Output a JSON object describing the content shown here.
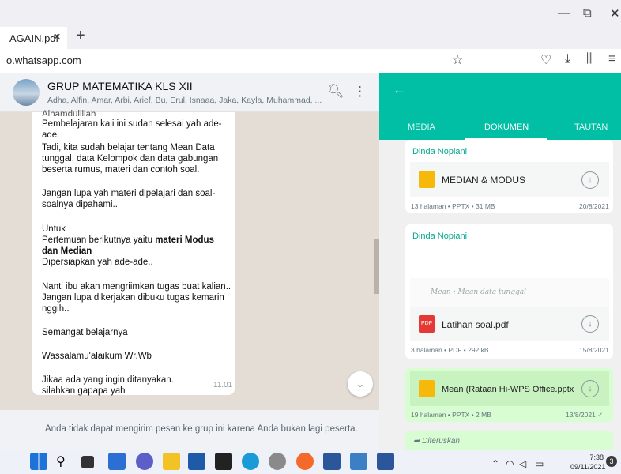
{
  "browser": {
    "tab_title": "AGAIN.pdf",
    "tab_close": "×",
    "new_tab": "+",
    "url": "o.whatsapp.com",
    "win_min": "—",
    "win_restore": "⧉",
    "win_close": "✕"
  },
  "chat": {
    "group_name": "GRUP MATEMATIKA KLS XII",
    "members": "Adha, Alfin, Amar, Arbi, Arief, Bu, Erul, Isnaaa, Jaka, Kayla, Muhammad, ...",
    "message": {
      "line_top": "Alhamdulillah",
      "line1": "Pembelajaran kali ini sudah selesai yah ade-ade.",
      "para2": "Tadi, kita sudah belajar tentang Mean Data tunggal, data Kelompok dan data gabungan beserta rumus, materi dan contoh soal.",
      "para3": "Jangan lupa yah materi dipelajari dan soal-soalnya dipahami..",
      "untuk": "Untuk",
      "pertemuan": "Pertemuan berikutnya yaitu ",
      "bold": "materi Modus dan Median",
      "dipersiapkan": "Dipersiapkan yah ade-ade..",
      "para5": "Nanti ibu akan mengriimkan tugas buat kalian.. Jangan lupa dikerjakan dibuku tugas kemarin nggih..",
      "para6": "Semangat belajarnya",
      "para7": "Wassalamu'alaikum Wr.Wb",
      "para8": "Jikaa ada yang ingin ditanyakan.. silahkan gapapa yah",
      "time": "11.01"
    },
    "blocked_notice": "Anda tidak dapat mengirim pesan ke grup ini karena Anda bukan lagi peserta."
  },
  "media": {
    "tabs": [
      "MEDIA",
      "DOKUMEN",
      "TAUTAN"
    ],
    "docs": [
      {
        "sender": "Dinda Nopiani",
        "name": "MEDIAN & MODUS",
        "meta": "13 halaman • PPTX • 31 MB",
        "date": "20/8/2021"
      },
      {
        "sender": "Dinda Nopiani",
        "name": "Latihan soal.pdf",
        "meta": "3 halaman • PDF • 292 kB",
        "date": "15/8/2021",
        "preview": "Mean : Mean data tunggal"
      },
      {
        "name": "Mean (Rataan Hi-WPS Office.pptx",
        "meta": "19 halaman • PPTX • 2 MB",
        "date": "13/8/2021 ✓"
      }
    ],
    "forwarded": "Diteruskan"
  },
  "taskbar": {
    "time": "7:38",
    "date": "09/11/2021",
    "notif_count": "3"
  },
  "colors": {
    "accent": "#00bfa5",
    "pptx": "#f6b90a",
    "pdf": "#e53935"
  }
}
